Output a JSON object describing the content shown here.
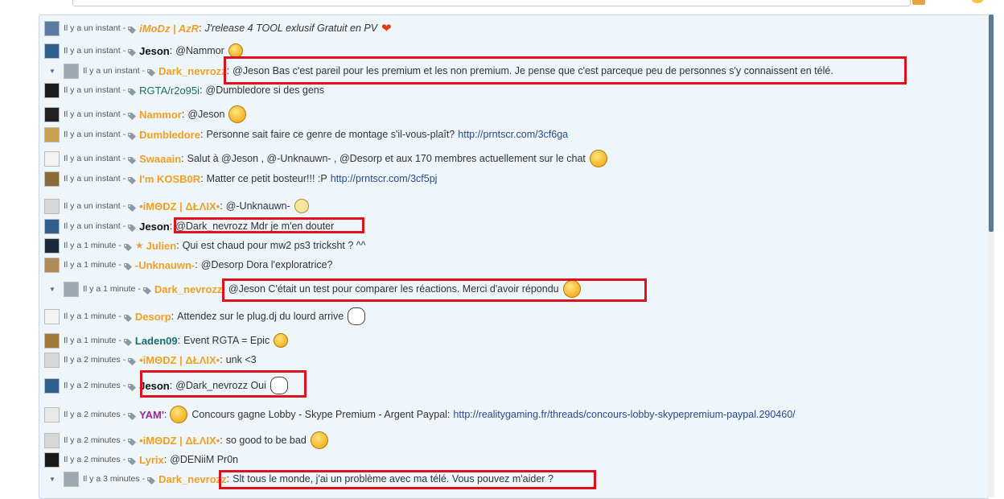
{
  "colors": {
    "panel_bg": "#eef5fb",
    "highlight": "#e0111b",
    "orange_user": "#f0a020",
    "teal_user": "#1a6e6e",
    "purple_user": "#9b2a9b",
    "black_user": "#111111",
    "link": "#2a4a8a"
  },
  "messages": [
    {
      "time": "Il y a un instant",
      "user": "iMoDz | AzR",
      "user_color": "#f0a020",
      "italic": true,
      "text": "J'release 4 TOOL exlusif Gratuit en PV",
      "emoji": "heart-icon",
      "avatar_color": "#5a7aa0"
    },
    {
      "time": "Il y a un instant",
      "user": "Jeson",
      "user_color": "#111111",
      "text": "@Nammor",
      "emoji": "shocked-icon",
      "avatar_color": "#2f5f8a"
    },
    {
      "time": "Il y a un instant",
      "user": "Dark_nevrozz",
      "user_color": "#f0a020",
      "text": "@Jeson Bas c'est pareil pour les premium et les non premium. Je pense que c'est parceque peu de personnes s'y connaissent en télé.",
      "collapse": true,
      "avatar_color": "#9aa8b0"
    },
    {
      "time": "Il y a un instant",
      "user": "RGTA/r2o95i",
      "user_color": "#1a6e6e",
      "normal_weight": true,
      "text": "@Dumbledore si des gens",
      "avatar_color": "#1c1c1c"
    },
    {
      "time": "Il y a un instant",
      "user": "Nammor",
      "user_color": "#f0a020",
      "text": "@Jeson",
      "emoji": "tongue-icon",
      "avatar_color": "#222222"
    },
    {
      "time": "Il y a un instant",
      "user": "Dumbledore",
      "user_color": "#f0a020",
      "text": "Personne sait faire ce genre de montage s'il-vous-plaît?",
      "link": "http://prntscr.com/3cf6ga",
      "avatar_color": "#c8a050"
    },
    {
      "time": "Il y a un instant",
      "user": "Swaaain",
      "user_color": "#f0a020",
      "text": "Salut à @Jeson , @-Unknauwn- , @Desorp et aux 170 membres actuellement sur le chat",
      "emoji": "smile-icon",
      "avatar_color": "#f4f4f4"
    },
    {
      "time": "Il y a un instant",
      "user": "I'm KOSB0R",
      "user_color": "#f0a020",
      "text": "Matter ce petit bosteur!!! :P",
      "link": "http://prntscr.com/3cf5pj",
      "avatar_color": "#8a6a3a"
    },
    {
      "time": "Il y a un instant",
      "user": "•iMΘDZ | ΔŁΛIX•",
      "user_color": "#f0a020",
      "text": "@-Unknauwn-",
      "emoji": "faded-smile-icon",
      "avatar_color": "#d8d8d8"
    },
    {
      "time": "Il y a un instant",
      "user": "Jeson",
      "user_color": "#111111",
      "text": "@Dark_nevrozz Mdr je m'en douter",
      "avatar_color": "#2f5f8a"
    },
    {
      "time": "Il y a 1 minute",
      "user": "Julien",
      "user_color": "#f0a020",
      "star": true,
      "text": "Qui est chaud pour mw2 ps3 tricksht ? ^^",
      "avatar_color": "#1a2a3a"
    },
    {
      "time": "Il y a 1 minute",
      "user": "-Unknauwn-",
      "user_color": "#f0a020",
      "text": "@Desorp Dora l'exploratrice?",
      "avatar_color": "#b08a5a"
    },
    {
      "time": "Il y a 1 minute",
      "user": "Dark_nevrozz",
      "user_color": "#f0a020",
      "text": "@Jeson C'était un test pour comparer les réactions. Merci d'avoir répondu",
      "emoji": "smile-icon",
      "collapse": true,
      "avatar_color": "#9aa8b0"
    },
    {
      "time": "Il y a 1 minute",
      "user": "Desorp",
      "user_color": "#f0a020",
      "text": "Attendez sur le plug.dj du lourd arrive",
      "emoji": "troll-face-icon",
      "avatar_color": "#f4f4f4"
    },
    {
      "time": "Il y a 1 minute",
      "user": "Laden09",
      "user_color": "#1a6e6e",
      "text": "Event RGTA = Epic",
      "emoji": "grin-icon",
      "avatar_color": "#a07a3a"
    },
    {
      "time": "Il y a 2 minutes",
      "user": "•iMΘDZ | ΔŁΛIX•",
      "user_color": "#f0a020",
      "text": "unk <3",
      "avatar_color": "#d8d8d8"
    },
    {
      "time": "Il y a 2 minutes",
      "user": "Jeson",
      "user_color": "#111111",
      "text": "@Dark_nevrozz Oui",
      "emoji": "troll-face-icon",
      "avatar_color": "#2f5f8a"
    },
    {
      "time": "Il y a 2 minutes",
      "user": "YAM'",
      "user_color": "#9b2a9b",
      "text": "Concours gagne Lobby - Skype Premium - Argent Paypal:",
      "link": "http://realitygaming.fr/threads/concours-lobby-skypepremium-paypal.290460/",
      "emoji_before": "police-smiley-icon",
      "avatar_color": "#e8e8e8"
    },
    {
      "time": "Il y a 2 minutes",
      "user": "•iMΘDZ | ΔŁΛIX•",
      "user_color": "#f0a020",
      "text": "so good to be bad",
      "emoji": "headphones-smiley-icon",
      "avatar_color": "#d8d8d8"
    },
    {
      "time": "Il y a 2 minutes",
      "user": "Lyrix",
      "user_color": "#f0a020",
      "text": "@DENiiM Pr0n",
      "avatar_color": "#1a1a1a"
    },
    {
      "time": "Il y a 3 minutes",
      "user": "Dark_nevrozz",
      "user_color": "#f0a020",
      "text": "Slt tous le monde, j'ai un problème avec ma télé. Vous pouvez m'aider ?",
      "collapse": true,
      "avatar_color": "#9aa8b0"
    }
  ]
}
